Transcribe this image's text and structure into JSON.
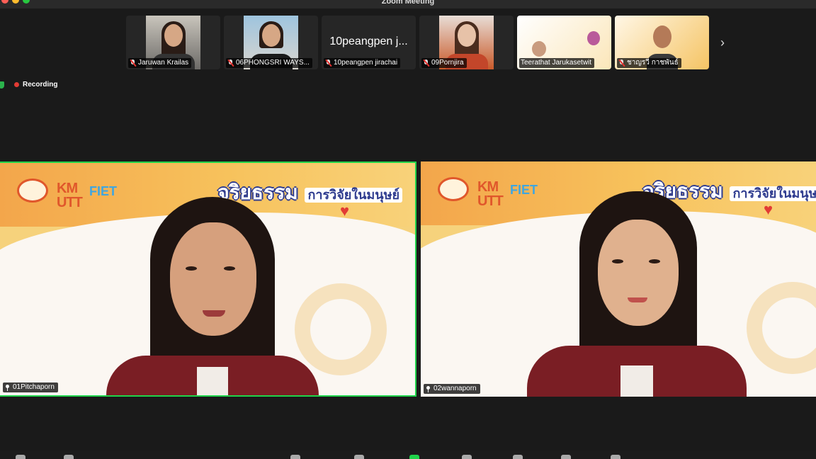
{
  "window": {
    "title": "Zoom Meeting"
  },
  "gallery": {
    "participants": [
      {
        "name": "Jaruwan Krailas",
        "muted": true
      },
      {
        "name": "06PHONGSRI WAYS...",
        "muted": true
      },
      {
        "name": "10peangpen jirachai",
        "display": "10peangpen j...",
        "muted": true
      },
      {
        "name": "09Pornjira",
        "muted": true
      },
      {
        "name": "Teerathat Jarukasetwit",
        "muted": false
      },
      {
        "name": "ชาญรวี กาชพันธ์",
        "muted": true
      }
    ]
  },
  "recording": {
    "label": "Recording"
  },
  "main": {
    "banner": {
      "title": "จริยธรรม",
      "subtitle": "การวิจัยในมนุษย์",
      "km": "KM\nUTT",
      "fiet": "FIET"
    },
    "speakers": [
      {
        "name": "01Pitchaporn",
        "active": true
      },
      {
        "name": "02wannaporn",
        "active": false
      }
    ]
  },
  "colors": {
    "active_border": "#1fd34a",
    "recording": "#e23b34",
    "banner_blue": "#2f3c8f"
  }
}
